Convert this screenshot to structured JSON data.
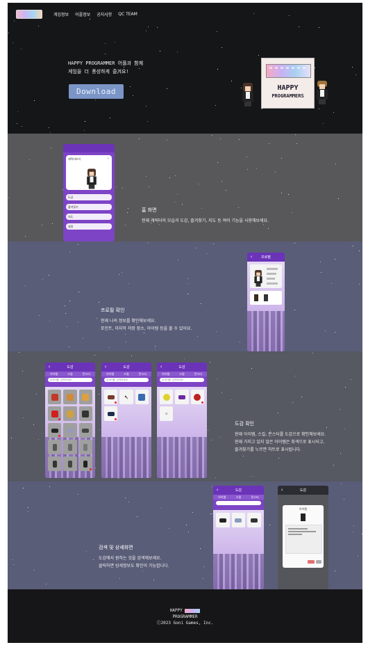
{
  "nav": {
    "items": [
      "게임정보",
      "어플정보",
      "공지사항",
      "QC TEAM"
    ]
  },
  "hero": {
    "line1": "HAPPY PROGRAMMER 어플과 함께",
    "line2": "게임을 더 풍성하게 즐겨요!",
    "download_label": "Download",
    "logo_title": "HAPPY",
    "logo_subtitle": "PROGRAMMERS"
  },
  "home_section": {
    "title": "홈 화면",
    "desc": "현재 캐릭터의 모습과 도감, 즐겨찾기, 지도 등 여러 기능을 사용해보세요.",
    "phone": {
      "character_label": "캐릭터보기",
      "menu": [
        "도감",
        "즐겨찾기",
        "지도",
        "설정"
      ]
    }
  },
  "profile_section": {
    "title": "프로필 확인",
    "desc1": "현재 나의 정보를 확인해보세요.",
    "desc2": "포인트, 미지막 저장 장소, 아이템 등을 볼 수 있어요.",
    "phone": {
      "header": "프로필"
    }
  },
  "dex_section": {
    "title": "도감 확인",
    "desc1": "현재 아이템, 스킬, 몬스터를 도감으로 확인해보세요.",
    "desc2": "현재 가지고 있지 않은 아이템은 회색으로 표시되고,",
    "desc3": "즐겨찾기를 누르면 하트로 표시됩니다.",
    "phone_header": "도감",
    "tabs": [
      "아이템",
      "스킬",
      "몬스터"
    ],
    "search_placeholder": "검색어를 입력하세요"
  },
  "detail_section": {
    "title": "검색 및 상세화면",
    "desc1": "도감에서 원하는 것을 검색해보세요.",
    "desc2": "클릭하면 상세정보도 확인이 가능합니다.",
    "phone_header": "도감",
    "popup_title": "아이템"
  },
  "footer": {
    "brand_line1": "HAPPY",
    "brand_line2": "PROGRAMMER",
    "copyright": "ⓒ2023 Goni Games, Inc."
  },
  "colors": {
    "hero_bg": "#151618",
    "phone_purple": "#7d44c6",
    "download_button": "#7a95c6"
  }
}
